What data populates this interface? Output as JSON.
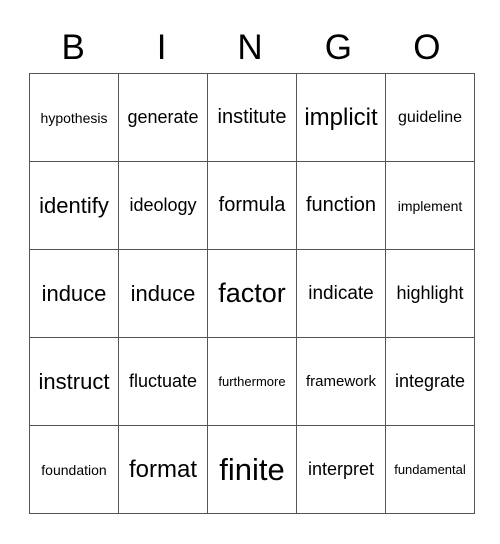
{
  "header": [
    "B",
    "I",
    "N",
    "G",
    "O"
  ],
  "rows": [
    [
      "hypothesis",
      "generate",
      "institute",
      "implicit",
      "guideline"
    ],
    [
      "identify",
      "ideology",
      "formula",
      "function",
      "implement"
    ],
    [
      "induce",
      "induce",
      "factor",
      "indicate",
      "highlight"
    ],
    [
      "instruct",
      "fluctuate",
      "furthermore",
      "framework",
      "integrate"
    ],
    [
      "foundation",
      "format",
      "finite",
      "interpret",
      "fundamental"
    ]
  ]
}
